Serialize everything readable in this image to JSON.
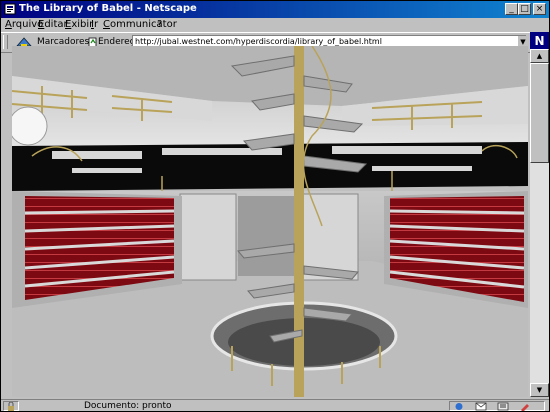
{
  "window": {
    "title": "The Library of Babel - Netscape",
    "controls": {
      "minimize": "_",
      "maximize": "□",
      "close": "×"
    }
  },
  "menu": {
    "items": [
      {
        "label": "Arquivo"
      },
      {
        "label": "Editar"
      },
      {
        "label": "Exibir"
      },
      {
        "label": "Ir"
      },
      {
        "label": "Communicator"
      },
      {
        "label": "?"
      }
    ]
  },
  "toolbar": {
    "bookmarks_label": "Marcadores",
    "address_label": "Endereço:",
    "address_value": "http://jubal.westnet.com/hyperdiscordia/library_of_babel.html"
  },
  "logo": {
    "letter": "N"
  },
  "status": {
    "text": "Documento: pronto"
  },
  "colors": {
    "titlebar_start": "#000080",
    "titlebar_end": "#1084d0",
    "chrome": "#c0c0c0",
    "books": "#8b0d14",
    "brass": "#b9a35a",
    "stone": "#cfcfcf"
  },
  "icons": [
    "netscape-page-icon",
    "bookmark-icon",
    "address-icon",
    "lock-icon",
    "mail-icon",
    "news-icon"
  ]
}
